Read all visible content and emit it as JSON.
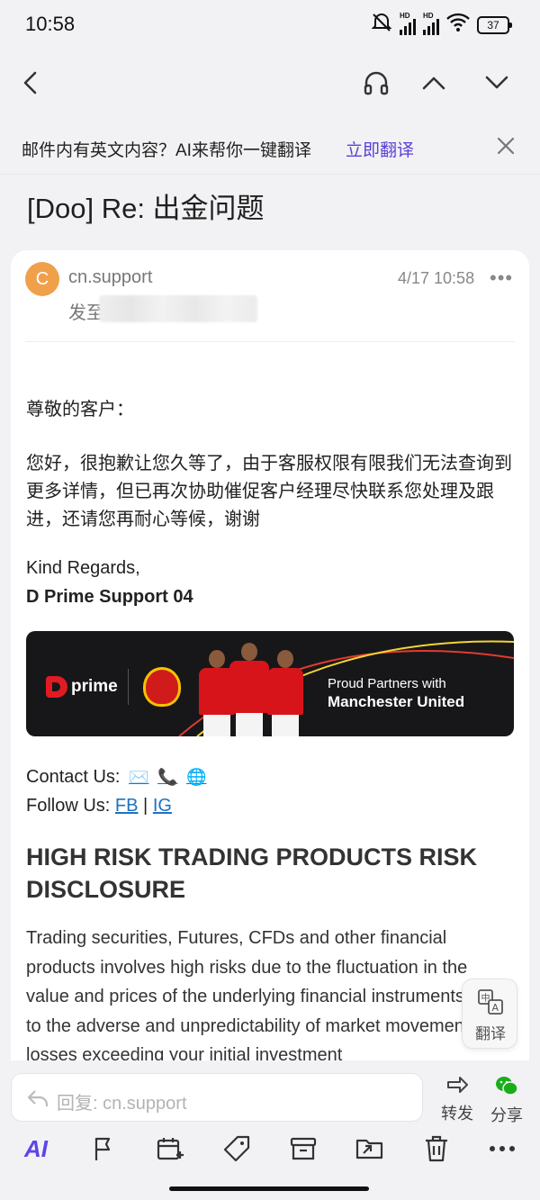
{
  "status_bar": {
    "time": "10:58",
    "battery": "37"
  },
  "translate_banner": {
    "text": "邮件内有英文内容？AI来帮你一键翻译",
    "action": "立即翻译"
  },
  "email": {
    "subject": "[Doo] Re: 出金问题",
    "sender_initial": "C",
    "sender": "cn.support",
    "recipient_label": "发至",
    "date": "4/17 10:58",
    "more": "•••",
    "greeting": "尊敬的客户：",
    "paragraph": "您好，很抱歉让您久等了，由于客服权限有限我们无法查询到更多详情，但已再次协助催促客户经理尽快联系您处理及跟进，还请您再耐心等候，谢谢",
    "regards": "Kind Regards,",
    "signature": "D Prime Support 04",
    "promo": {
      "brand": "prime",
      "line1": "Proud Partners with",
      "line2": "Manchester United"
    },
    "contact_label": "Contact Us:",
    "contact_icons": [
      "✉️",
      "📞",
      "🌐"
    ],
    "follow_label": "Follow Us:",
    "follow_links": [
      "FB",
      "IG"
    ],
    "follow_separator": "|",
    "risk_heading": "HIGH RISK TRADING PRODUCTS RISK DISCLOSURE",
    "risk_body": "Trading securities, Futures, CFDs and other financial products involves high risks due to the fluctuation in the value and prices of the underlying financial instruments. Due to the adverse and unpredictability of market movements, losses exceeding your initial investment"
  },
  "translate_fab": {
    "label": "翻译"
  },
  "reply": {
    "placeholder": "回复: cn.support",
    "forward": "转发",
    "share": "分享"
  },
  "toolbar": {
    "ai": "AI"
  },
  "colors": {
    "accent": "#5b46e6",
    "link": "#1d72c2",
    "avatar": "#f0a04b",
    "wechat": "#1aad19"
  }
}
